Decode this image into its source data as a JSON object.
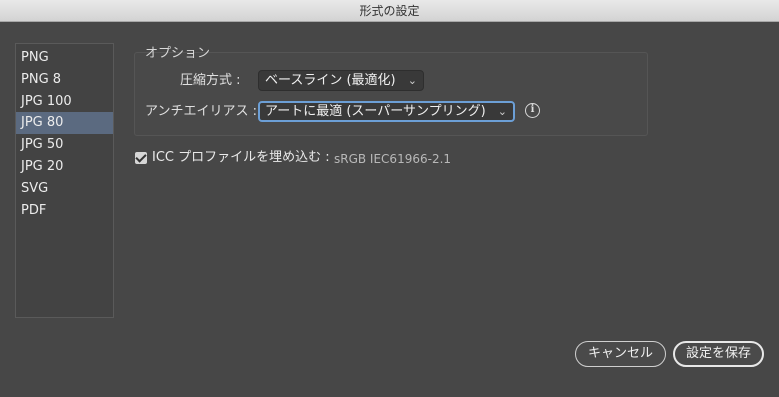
{
  "window": {
    "title": "形式の設定"
  },
  "formats": {
    "items": [
      "PNG",
      "PNG 8",
      "JPG 100",
      "JPG 80",
      "JPG 50",
      "JPG 20",
      "SVG",
      "PDF"
    ],
    "selected": "JPG 80"
  },
  "options": {
    "group_label": "オプション",
    "compression": {
      "label": "圧縮方式 :",
      "value": "ベースライン (最適化)"
    },
    "antialias": {
      "label": "アンチエイリアス :",
      "value": "アートに最適 (スーパーサンプリング)"
    },
    "info_glyph": "i"
  },
  "icc": {
    "checked": true,
    "label": "ICC プロファイルを埋め込む :",
    "value": "sRGB IEC61966-2.1"
  },
  "buttons": {
    "cancel": "キャンセル",
    "save": "設定を保存"
  },
  "colors": {
    "selection": "#5b6a80",
    "focus_ring": "#6c9fd6",
    "background": "#474747"
  }
}
